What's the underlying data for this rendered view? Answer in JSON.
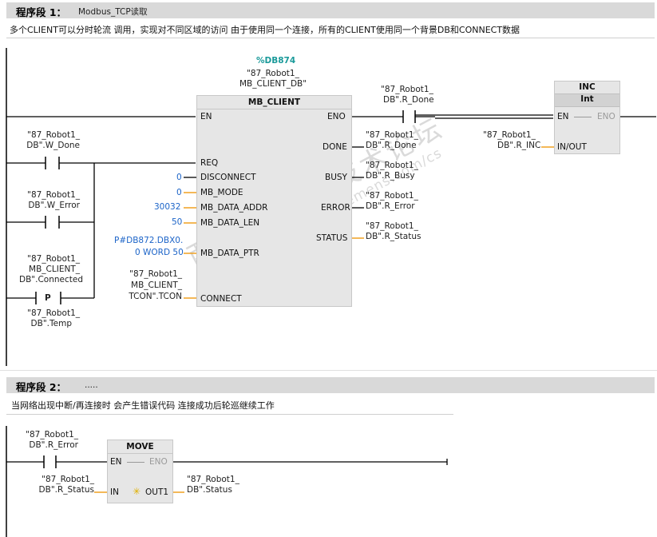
{
  "network1": {
    "label": "程序段 1：",
    "title": "Modbus_TCP读取",
    "comment": "多个CLIENT可以分时轮流 调用，实现对不同区域的访问 由于使用同一个连接，所有的CLIENT使用同一个背景DB和CONNECT数据",
    "contacts": {
      "w_done": [
        "\"87_Robot1_",
        "DB\".W_Done"
      ],
      "w_error": [
        "\"87_Robot1_",
        "DB\".W_Error"
      ],
      "connected": [
        "\"87_Robot1_",
        "MB_CLIENT_",
        "DB\".Connected"
      ],
      "p_label": "P",
      "temp": [
        "\"87_Robot1_",
        "DB\".Temp"
      ],
      "r_done_contact": [
        "\"87_Robot1_",
        "DB\".R_Done"
      ]
    },
    "mb_client": {
      "db_address": "%DB874",
      "instance": [
        "\"87_Robot1_",
        "MB_CLIENT_DB\""
      ],
      "name": "MB_CLIENT",
      "inputs": {
        "en": "EN",
        "req": "REQ",
        "disconnect": "DISCONNECT",
        "mb_mode": "MB_MODE",
        "mb_data_addr": "MB_DATA_ADDR",
        "mb_data_len": "MB_DATA_LEN",
        "mb_data_ptr": "MB_DATA_PTR",
        "connect": "CONNECT"
      },
      "outputs": {
        "eno": "ENO",
        "done": "DONE",
        "busy": "BUSY",
        "error": "ERROR",
        "status": "STATUS"
      },
      "values": {
        "disconnect": "0",
        "mb_mode": "0",
        "mb_data_addr": "30032",
        "mb_data_len": "50",
        "mb_data_ptr": [
          "P#DB872.DBX0.",
          "0 WORD 50"
        ],
        "connect": [
          "\"87_Robot1_",
          "MB_CLIENT_",
          "TCON\".TCON"
        ]
      },
      "out_values": {
        "done": [
          "\"87_Robot1_",
          "DB\".R_Done"
        ],
        "busy": [
          "\"87_Robot1_",
          "DB\".R_Busy"
        ],
        "error": [
          "\"87_Robot1_",
          "DB\".R_Error"
        ],
        "status": [
          "\"87_Robot1_",
          "DB\".R_Status"
        ]
      }
    },
    "inc": {
      "name": "INC",
      "type": "Int",
      "en": "EN",
      "eno": "ENO",
      "in_out": "IN/OUT",
      "operand": [
        "\"87_Robot1_",
        "DB\".R_INC"
      ]
    }
  },
  "network2": {
    "label": "程序段 2：",
    "title": ".....",
    "comment": "当网络出现中断/再连接时 会产生错误代码 连接成功后轮巡继续工作",
    "contact": [
      "\"87_Robot1_",
      "DB\".R_Error"
    ],
    "move": {
      "name": "MOVE",
      "en": "EN",
      "eno": "ENO",
      "in": "IN",
      "out1": "OUT1",
      "in_operand": [
        "\"87_Robot1_",
        "DB\".R_Status"
      ],
      "out_operand": [
        "\"87_Robot1_",
        "DB\".Status"
      ]
    }
  },
  "watermark": [
    "西门子工业 技术论坛",
    "support.industry.siemens.com/cs"
  ],
  "colors": {
    "wire": "#000000",
    "param_line": "#f0a020",
    "constant": "#1c64c8",
    "db": "#1a9a9a",
    "block_fill": "#e6e6e6"
  }
}
